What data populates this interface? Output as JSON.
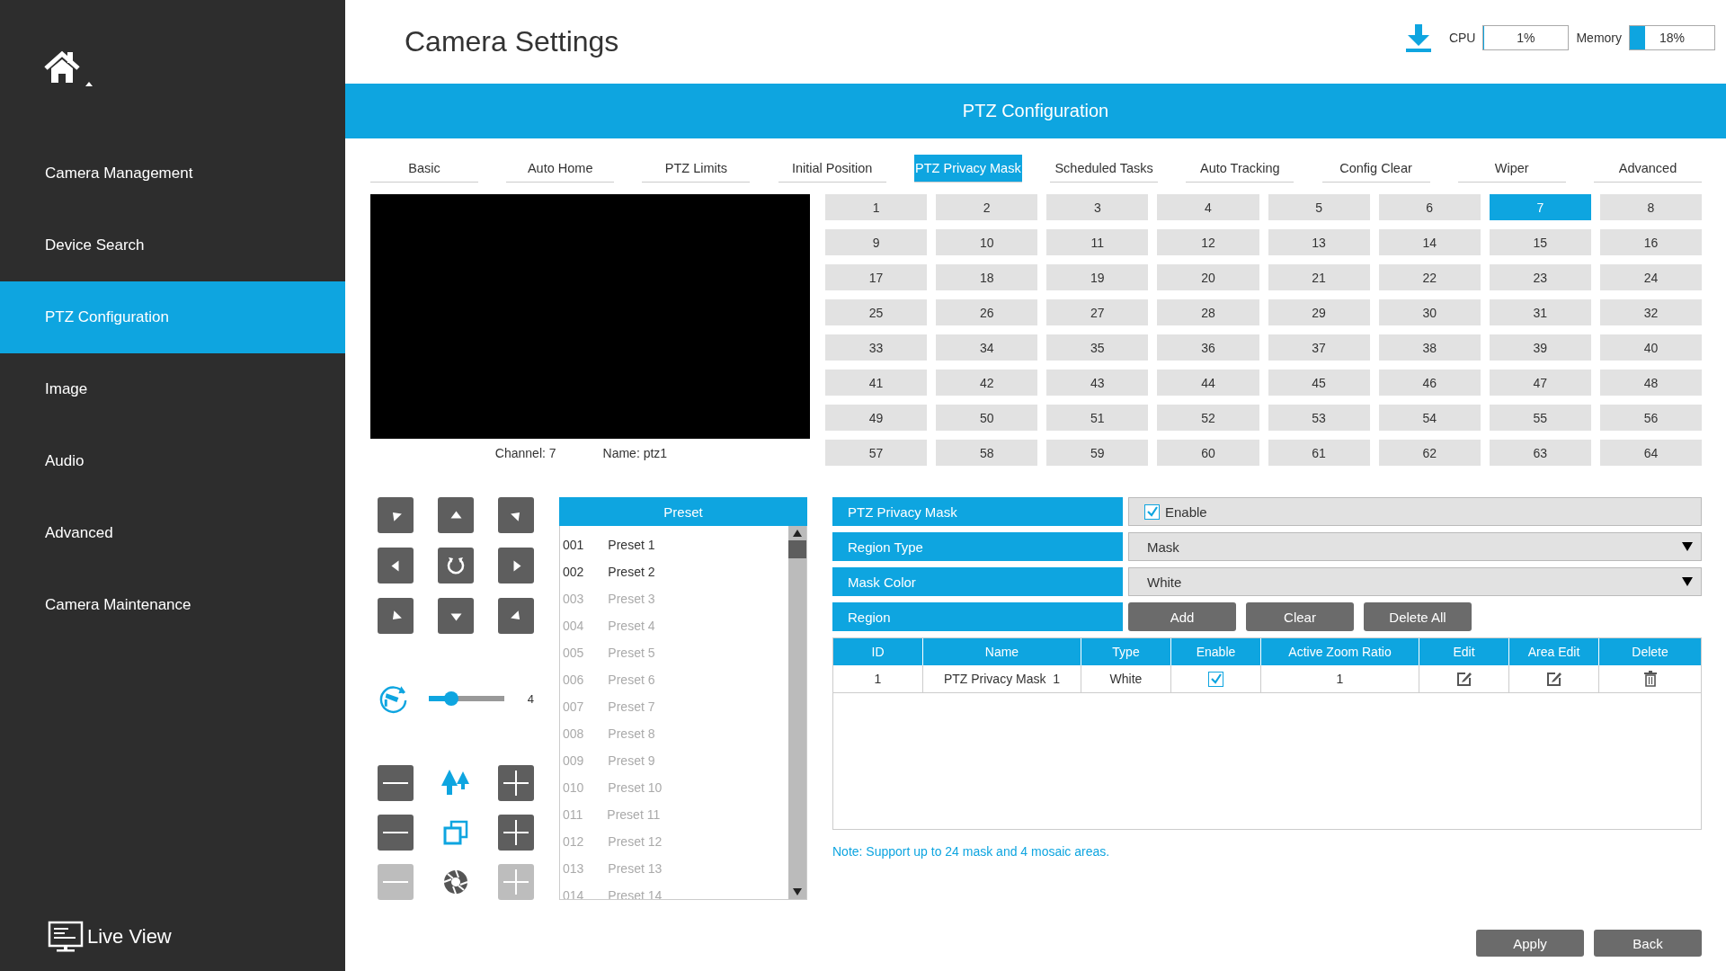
{
  "sidebar": {
    "items": [
      {
        "label": "Camera Management",
        "selected": false
      },
      {
        "label": "Device Search",
        "selected": false
      },
      {
        "label": "PTZ Configuration",
        "selected": true
      },
      {
        "label": "Image",
        "selected": false
      },
      {
        "label": "Audio",
        "selected": false
      },
      {
        "label": "Advanced",
        "selected": false
      },
      {
        "label": "Camera Maintenance",
        "selected": false
      }
    ],
    "live_view": "Live View"
  },
  "header": {
    "title": "Camera Settings",
    "cpu": {
      "label": "CPU",
      "value": "1%",
      "level": 0.01
    },
    "memory": {
      "label": "Memory",
      "value": "18%",
      "level": 0.18
    }
  },
  "section_title": "PTZ Configuration",
  "tabs": [
    {
      "label": "Basic",
      "selected": false
    },
    {
      "label": "Auto Home",
      "selected": false
    },
    {
      "label": "PTZ Limits",
      "selected": false
    },
    {
      "label": "Initial Position",
      "selected": false
    },
    {
      "label": "PTZ Privacy Mask",
      "selected": true
    },
    {
      "label": "Scheduled Tasks",
      "selected": false
    },
    {
      "label": "Auto Tracking",
      "selected": false
    },
    {
      "label": "Config Clear",
      "selected": false
    },
    {
      "label": "Wiper",
      "selected": false
    },
    {
      "label": "Advanced",
      "selected": false
    }
  ],
  "video": {
    "channel": "Channel: 7",
    "name": "Name: ptz1"
  },
  "channels": [
    {
      "label": "1",
      "selected": false
    },
    {
      "label": "2",
      "selected": false
    },
    {
      "label": "3",
      "selected": false
    },
    {
      "label": "4",
      "selected": false
    },
    {
      "label": "5",
      "selected": false
    },
    {
      "label": "6",
      "selected": false
    },
    {
      "label": "7",
      "selected": true
    },
    {
      "label": "8",
      "selected": false
    },
    {
      "label": "9",
      "selected": false
    },
    {
      "label": "10",
      "selected": false
    },
    {
      "label": "11",
      "selected": false
    },
    {
      "label": "12",
      "selected": false
    },
    {
      "label": "13",
      "selected": false
    },
    {
      "label": "14",
      "selected": false
    },
    {
      "label": "15",
      "selected": false
    },
    {
      "label": "16",
      "selected": false
    },
    {
      "label": "17",
      "selected": false
    },
    {
      "label": "18",
      "selected": false
    },
    {
      "label": "19",
      "selected": false
    },
    {
      "label": "20",
      "selected": false
    },
    {
      "label": "21",
      "selected": false
    },
    {
      "label": "22",
      "selected": false
    },
    {
      "label": "23",
      "selected": false
    },
    {
      "label": "24",
      "selected": false
    },
    {
      "label": "25",
      "selected": false
    },
    {
      "label": "26",
      "selected": false
    },
    {
      "label": "27",
      "selected": false
    },
    {
      "label": "28",
      "selected": false
    },
    {
      "label": "29",
      "selected": false
    },
    {
      "label": "30",
      "selected": false
    },
    {
      "label": "31",
      "selected": false
    },
    {
      "label": "32",
      "selected": false
    },
    {
      "label": "33",
      "selected": false
    },
    {
      "label": "34",
      "selected": false
    },
    {
      "label": "35",
      "selected": false
    },
    {
      "label": "36",
      "selected": false
    },
    {
      "label": "37",
      "selected": false
    },
    {
      "label": "38",
      "selected": false
    },
    {
      "label": "39",
      "selected": false
    },
    {
      "label": "40",
      "selected": false
    },
    {
      "label": "41",
      "selected": false
    },
    {
      "label": "42",
      "selected": false
    },
    {
      "label": "43",
      "selected": false
    },
    {
      "label": "44",
      "selected": false
    },
    {
      "label": "45",
      "selected": false
    },
    {
      "label": "46",
      "selected": false
    },
    {
      "label": "47",
      "selected": false
    },
    {
      "label": "48",
      "selected": false
    },
    {
      "label": "49",
      "selected": false
    },
    {
      "label": "50",
      "selected": false
    },
    {
      "label": "51",
      "selected": false
    },
    {
      "label": "52",
      "selected": false
    },
    {
      "label": "53",
      "selected": false
    },
    {
      "label": "54",
      "selected": false
    },
    {
      "label": "55",
      "selected": false
    },
    {
      "label": "56",
      "selected": false
    },
    {
      "label": "57",
      "selected": false
    },
    {
      "label": "58",
      "selected": false
    },
    {
      "label": "59",
      "selected": false
    },
    {
      "label": "60",
      "selected": false
    },
    {
      "label": "61",
      "selected": false
    },
    {
      "label": "62",
      "selected": false
    },
    {
      "label": "63",
      "selected": false
    },
    {
      "label": "64",
      "selected": false
    }
  ],
  "ptz": {
    "speed": {
      "level": 0.3,
      "value": "4"
    }
  },
  "preset_list": {
    "title": "Preset",
    "items": [
      {
        "number": "001",
        "name": "Preset 1",
        "disabled": false
      },
      {
        "number": "002",
        "name": "Preset 2",
        "disabled": false
      },
      {
        "number": "003",
        "name": "Preset 3",
        "disabled": true
      },
      {
        "number": "004",
        "name": "Preset 4",
        "disabled": true
      },
      {
        "number": "005",
        "name": "Preset 5",
        "disabled": true
      },
      {
        "number": "006",
        "name": "Preset 6",
        "disabled": true
      },
      {
        "number": "007",
        "name": "Preset 7",
        "disabled": true
      },
      {
        "number": "008",
        "name": "Preset 8",
        "disabled": true
      },
      {
        "number": "009",
        "name": "Preset 9",
        "disabled": true
      },
      {
        "number": "010",
        "name": "Preset 10",
        "disabled": true
      },
      {
        "number": "011",
        "name": "Preset 11",
        "disabled": true
      },
      {
        "number": "012",
        "name": "Preset 12",
        "disabled": true
      },
      {
        "number": "013",
        "name": "Preset 13",
        "disabled": true
      },
      {
        "number": "014",
        "name": "Preset 14",
        "disabled": true
      }
    ]
  },
  "form": {
    "rows": [
      {
        "label": "PTZ Privacy Mask",
        "kind": "checkbox",
        "text": "Enable",
        "checked": true
      },
      {
        "label": "Region Type",
        "kind": "select",
        "value": "Mask"
      },
      {
        "label": "Mask Color",
        "kind": "select",
        "value": "White"
      },
      {
        "label": "Region",
        "kind": "buttons",
        "buttons": [
          "Add",
          "Clear",
          "Delete All"
        ]
      }
    ]
  },
  "table": {
    "columns": [
      "ID",
      "Name",
      "Type",
      "Enable",
      "Active Zoom Ratio",
      "Edit",
      "Area Edit",
      "Delete"
    ],
    "rows": [
      {
        "id": "1",
        "name": "PTZ Privacy Mask  1",
        "type": "White",
        "enabled": true,
        "zoom_ratio": "1"
      }
    ]
  },
  "note": "Note: Support up to 24 mask and 4 mosaic areas.",
  "buttons": [
    "Apply",
    "Back"
  ]
}
